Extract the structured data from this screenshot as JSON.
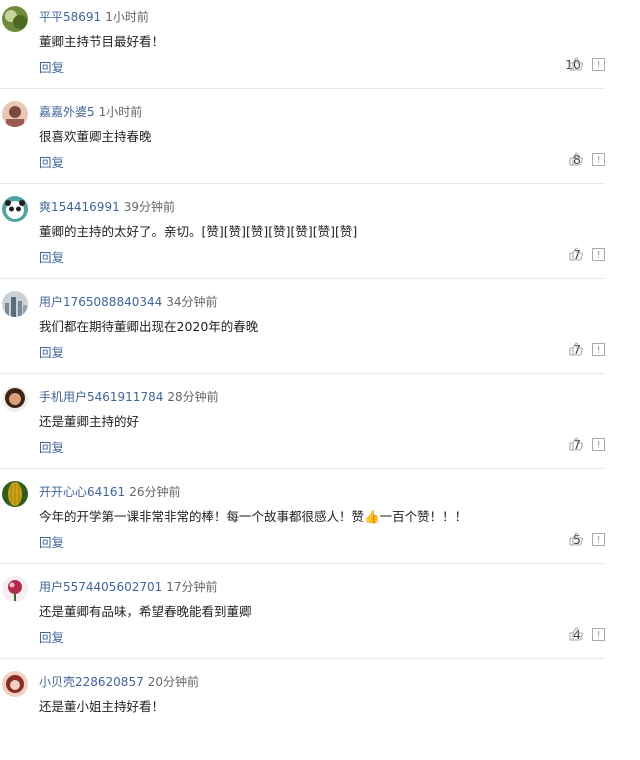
{
  "comments": [
    {
      "username": "平平58691",
      "time": "1小时前",
      "text": "董卿主持节目最好看！",
      "reply_label": "回复",
      "likes": "10",
      "avatar_color": "#6f8a3a",
      "avatar_accent": "#c5d49a"
    },
    {
      "username": "嘉嘉外婆5",
      "time": "1小时前",
      "text": "很喜欢董卿主持春晚",
      "reply_label": "回复",
      "likes": "8",
      "avatar_color": "#7a4a3c",
      "avatar_accent": "#e8c9b8"
    },
    {
      "username": "爽154416991",
      "time": "39分钟前",
      "text": "董卿的主持的太好了。亲切。[赞][赞][赞][赞][赞][赞][赞]",
      "reply_label": "回复",
      "likes": "7",
      "avatar_color": "#4fa3a0",
      "avatar_accent": "#ffffff"
    },
    {
      "username": "用户1765088840344",
      "time": "34分钟前",
      "text": "我们都在期待董卿出现在2020年的春晚",
      "reply_label": "回复",
      "likes": "7",
      "avatar_color": "#7b8896",
      "avatar_accent": "#c9d1d9"
    },
    {
      "username": "手机用户5461911784",
      "time": "28分钟前",
      "text": "还是董卿主持的好",
      "reply_label": "回复",
      "likes": "7",
      "avatar_color": "#3b2418",
      "avatar_accent": "#d9a07a"
    },
    {
      "username": "开开心心64161",
      "time": "26分钟前",
      "text": "今年的开学第一课非常非常的棒！每一个故事都很感人！赞👍一百个赞！！！",
      "reply_label": "回复",
      "likes": "5",
      "avatar_color": "#c9a21a",
      "avatar_accent": "#2f5e1c"
    },
    {
      "username": "用户5574405602701",
      "time": "17分钟前",
      "text": "还是董卿有品味，希望春晚能看到董卿",
      "reply_label": "回复",
      "likes": "4",
      "avatar_color": "#b52a4a",
      "avatar_accent": "#f2c4cf"
    },
    {
      "username": "小贝壳228620857",
      "time": "20分钟前",
      "text": "还是董小姐主持好看！",
      "reply_label": "回复",
      "likes": "",
      "avatar_color": "#8a2a2a",
      "avatar_accent": "#f0d0c0"
    }
  ],
  "icons": {
    "like": "thumbs-up-icon",
    "report": "report-icon"
  }
}
